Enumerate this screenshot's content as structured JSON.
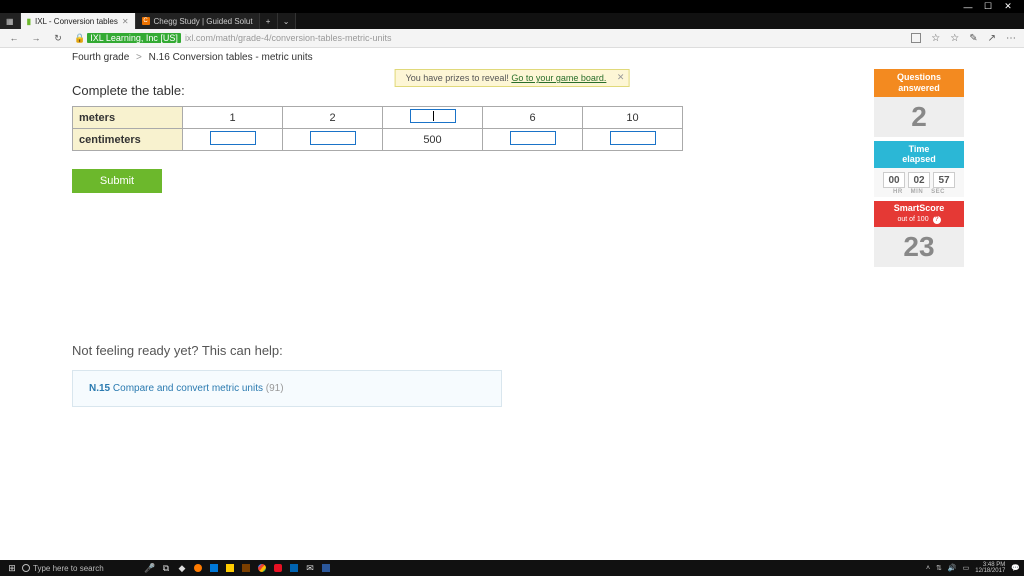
{
  "window": {
    "min": "—",
    "max": "☐",
    "close": "✕"
  },
  "tabs": {
    "t0": {
      "label": "IXL - Conversion tables"
    },
    "t1": {
      "label": "Chegg Study | Guided Solut"
    },
    "add": "+"
  },
  "addr": {
    "back": "←",
    "fwd": "→",
    "reload": "↻",
    "lock_label": "IXL Learning, Inc [US]",
    "url_rest": "ixl.com/math/grade-4/conversion-tables-metric-units",
    "star": "☆",
    "star2": "☆",
    "pen": "✎",
    "share": "↗",
    "more": "⋯"
  },
  "breadcrumb": {
    "grade": "Fourth grade",
    "sep": ">",
    "skill": "N.16 Conversion tables - metric units"
  },
  "notice": {
    "text": "You have prizes to reveal! ",
    "link": "Go to your game board.",
    "close": "✕"
  },
  "prompt": "Complete the table:",
  "table": {
    "rows": {
      "r0": {
        "hd": "meters",
        "c0": "1",
        "c1": "2",
        "c2_input": "",
        "c3": "6",
        "c4": "10"
      },
      "r1": {
        "hd": "centimeters",
        "c0_input": "",
        "c1_input": "",
        "c2": "500",
        "c3_input": "",
        "c4_input": ""
      }
    }
  },
  "submit": "Submit",
  "stats": {
    "questions": {
      "label": "Questions\nanswered",
      "value": "2"
    },
    "time": {
      "label": "Time\nelapsed",
      "hr": "00",
      "min": "02",
      "sec": "57",
      "hr_l": "HR",
      "min_l": "MIN",
      "sec_l": "SEC"
    },
    "smart": {
      "label": "SmartScore",
      "sub": "out of 100",
      "value": "23"
    }
  },
  "help": {
    "heading": "Not feeling ready yet? This can help:",
    "code": "N.15",
    "title": "Compare and convert metric units",
    "score": "(91)"
  },
  "taskbar": {
    "search_placeholder": "Type here to search",
    "time": "3:48 PM",
    "date": "12/18/2017"
  }
}
